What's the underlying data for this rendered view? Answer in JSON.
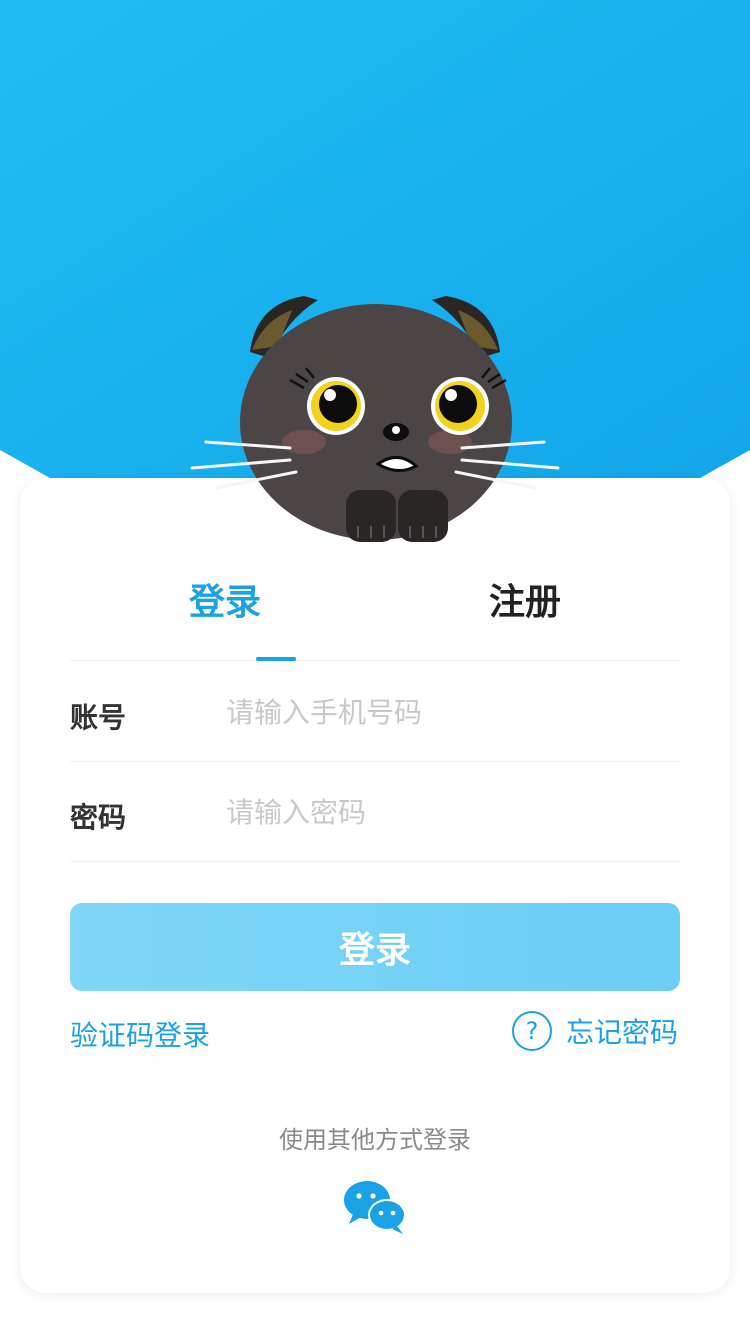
{
  "tabs": [
    {
      "label": "登录",
      "active": true
    },
    {
      "label": "注册",
      "active": false
    }
  ],
  "form": {
    "account": {
      "label": "账号",
      "placeholder": "请输入手机号码",
      "value": ""
    },
    "password": {
      "label": "密码",
      "placeholder": "请输入密码",
      "value": ""
    }
  },
  "actions": {
    "login_button": "登录",
    "sms_login": "验证码登录",
    "forgot_password": "忘记密码",
    "forgot_icon": "?"
  },
  "other_login": {
    "title": "使用其他方式登录",
    "providers": [
      {
        "name": "wechat",
        "icon": "wechat-icon"
      }
    ]
  },
  "colors": {
    "accent": "#1aa1e6",
    "header_bg": "#1ab4f0",
    "button_bg": "#7fd6f7",
    "mascot_fur": "#4b4645"
  }
}
